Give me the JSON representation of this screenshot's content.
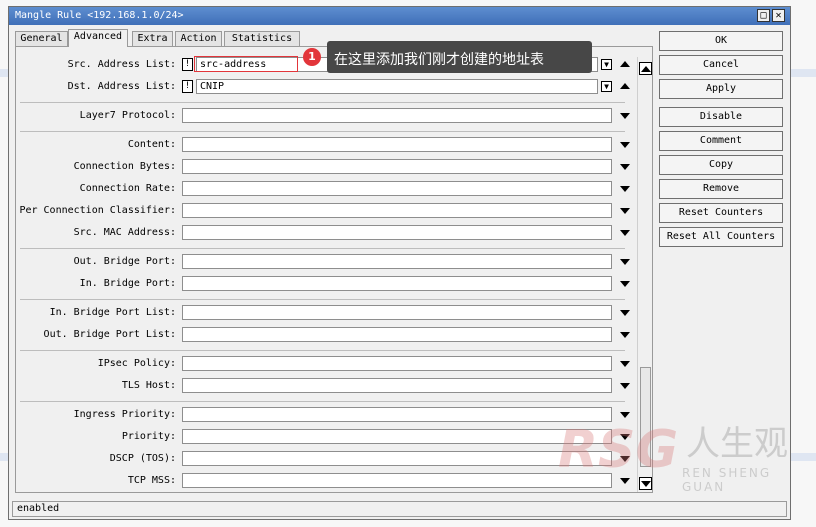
{
  "window": {
    "title": "Mangle Rule <192.168.1.0/24>",
    "restore_glyph": "□",
    "close_glyph": "✕"
  },
  "tabs": [
    {
      "label": "General",
      "active": false
    },
    {
      "label": "Advanced",
      "active": true
    },
    {
      "label": "Extra",
      "active": false
    },
    {
      "label": "Action",
      "active": false
    },
    {
      "label": "Statistics",
      "active": false
    }
  ],
  "fields": {
    "src_address_list": {
      "label": "Src. Address List:",
      "value": "src-address",
      "negate": "!"
    },
    "dst_address_list": {
      "label": "Dst. Address List:",
      "value": "CNIP",
      "negate": "!"
    },
    "layer7_protocol": {
      "label": "Layer7 Protocol:",
      "value": ""
    },
    "content": {
      "label": "Content:",
      "value": ""
    },
    "connection_bytes": {
      "label": "Connection Bytes:",
      "value": ""
    },
    "connection_rate": {
      "label": "Connection Rate:",
      "value": ""
    },
    "per_connection_classifier": {
      "label": "Per Connection Classifier:",
      "value": ""
    },
    "src_mac_address": {
      "label": "Src. MAC Address:",
      "value": ""
    },
    "out_bridge_port": {
      "label": "Out. Bridge Port:",
      "value": ""
    },
    "in_bridge_port": {
      "label": "In. Bridge Port:",
      "value": ""
    },
    "in_bridge_port_list": {
      "label": "In. Bridge Port List:",
      "value": ""
    },
    "out_bridge_port_list": {
      "label": "Out. Bridge Port List:",
      "value": ""
    },
    "ipsec_policy": {
      "label": "IPsec Policy:",
      "value": ""
    },
    "tls_host": {
      "label": "TLS Host:",
      "value": ""
    },
    "ingress_priority": {
      "label": "Ingress Priority:",
      "value": ""
    },
    "priority": {
      "label": "Priority:",
      "value": ""
    },
    "dscp_tos": {
      "label": "DSCP (TOS):",
      "value": ""
    },
    "tcp_mss": {
      "label": "TCP MSS:",
      "value": ""
    }
  },
  "buttons": {
    "ok": "OK",
    "cancel": "Cancel",
    "apply": "Apply",
    "disable": "Disable",
    "comment": "Comment",
    "copy": "Copy",
    "remove": "Remove",
    "reset_counters": "Reset Counters",
    "reset_all_counters": "Reset All Counters"
  },
  "status": "enabled",
  "annotation": {
    "number": "1",
    "text": "在这里添加我们刚才创建的地址表",
    "color": "#e2353a"
  },
  "watermark": {
    "logo": "RSG",
    "cn": "人生观",
    "en": "REN SHENG GUAN"
  },
  "colors": {
    "titlebar": "#4a7cc4",
    "callout_bg": "#474747",
    "highlight": "#e2353a"
  }
}
